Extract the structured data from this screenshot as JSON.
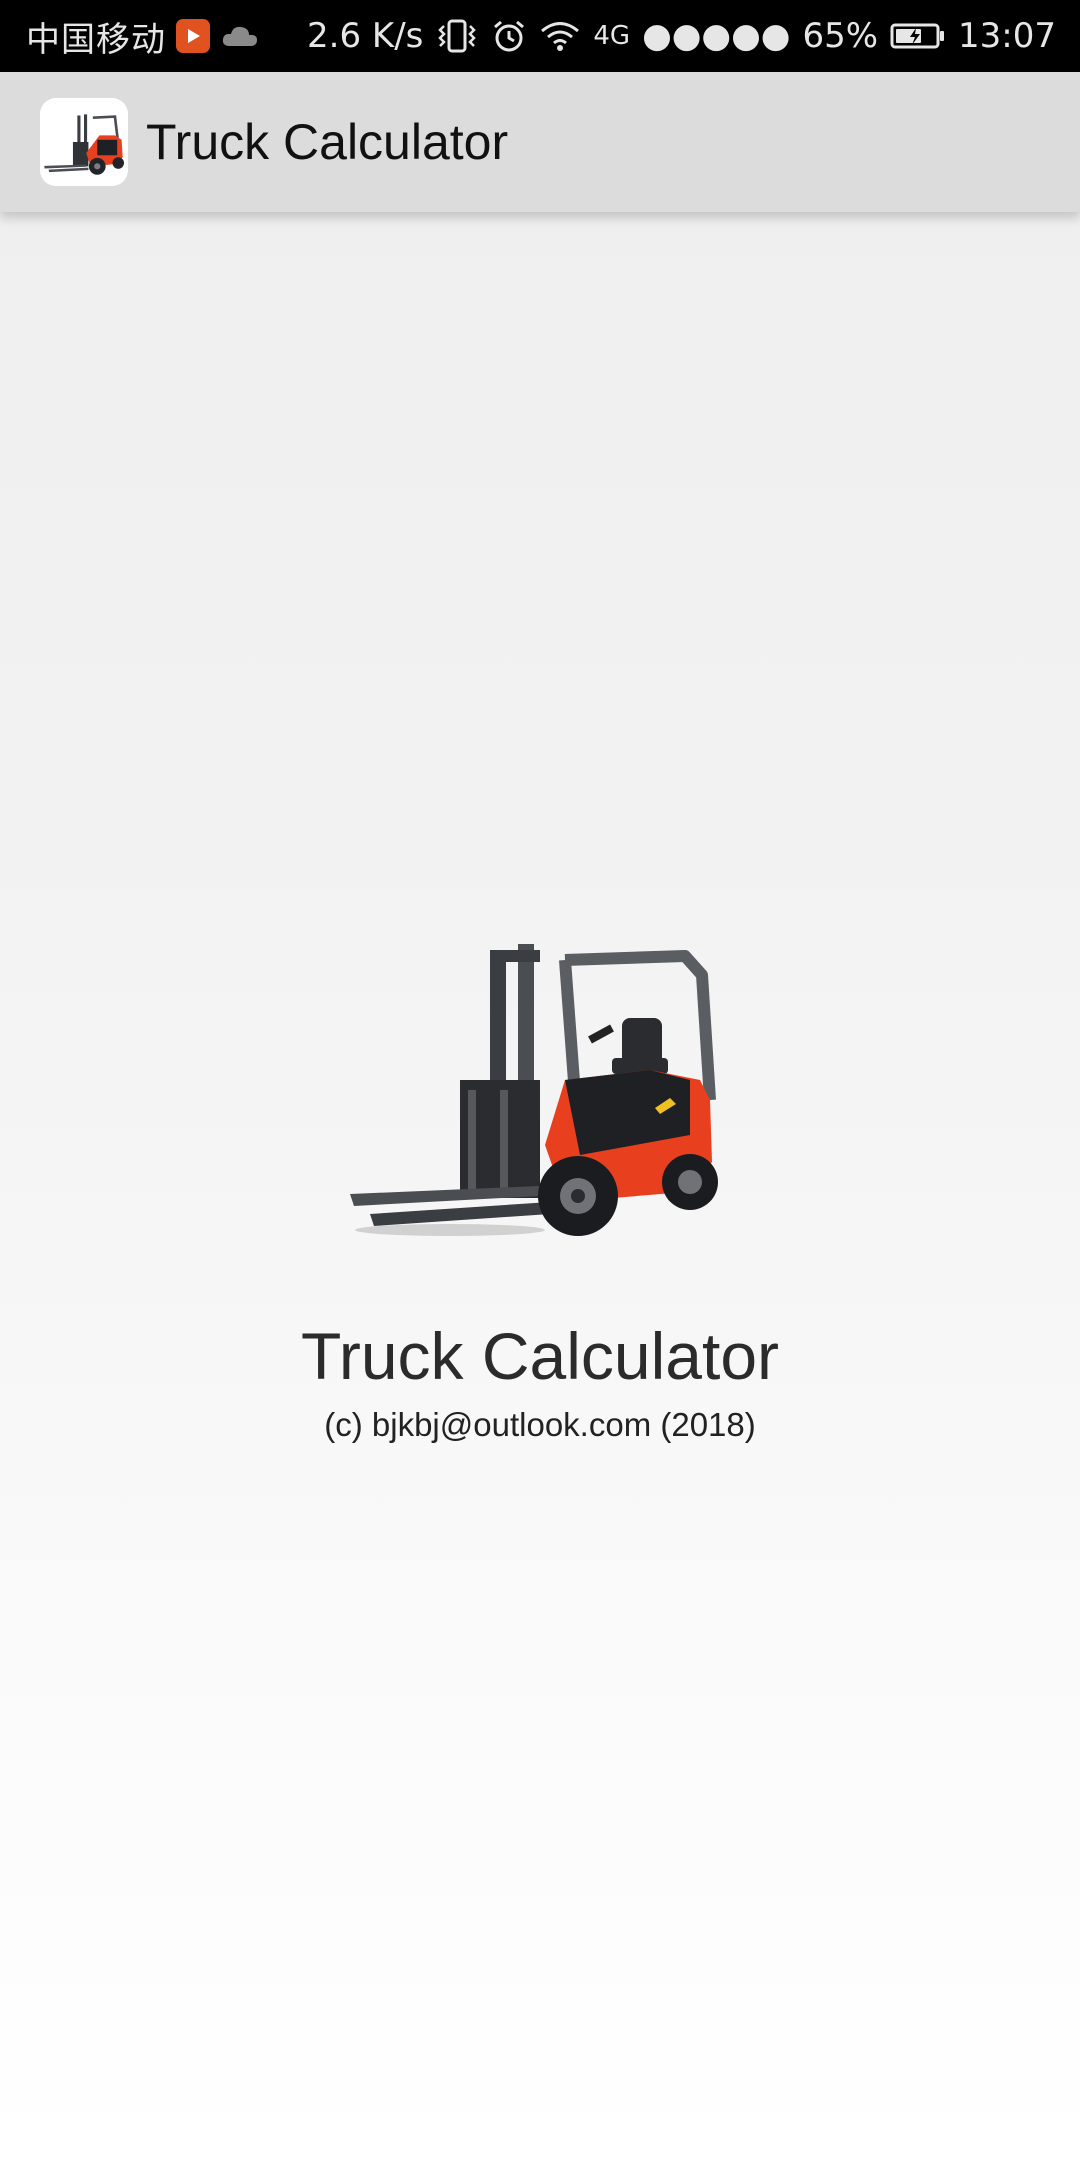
{
  "status_bar": {
    "carrier": "中国移动",
    "network_speed": "2.6 K/s",
    "network_type": "4G",
    "signal": "●●●●●",
    "battery": "65%",
    "battery_level": 0.65,
    "time": "13:07",
    "icons": [
      "video-app-icon",
      "cloud-icon",
      "vibrate-icon",
      "alarm-icon",
      "wifi-icon",
      "battery-icon"
    ]
  },
  "app_bar": {
    "title": "Truck Calculator",
    "icon": "forklift-icon"
  },
  "splash": {
    "image": "forklift-image",
    "title": "Truck Calculator",
    "copyright": "(c) bjkbj@outlook.com (2018)"
  },
  "colors": {
    "status_bar_bg": "#000000",
    "app_bar_bg": "#dcdcdc",
    "forklift_body": "#e8401f",
    "forklift_frame": "#3a3d42"
  }
}
